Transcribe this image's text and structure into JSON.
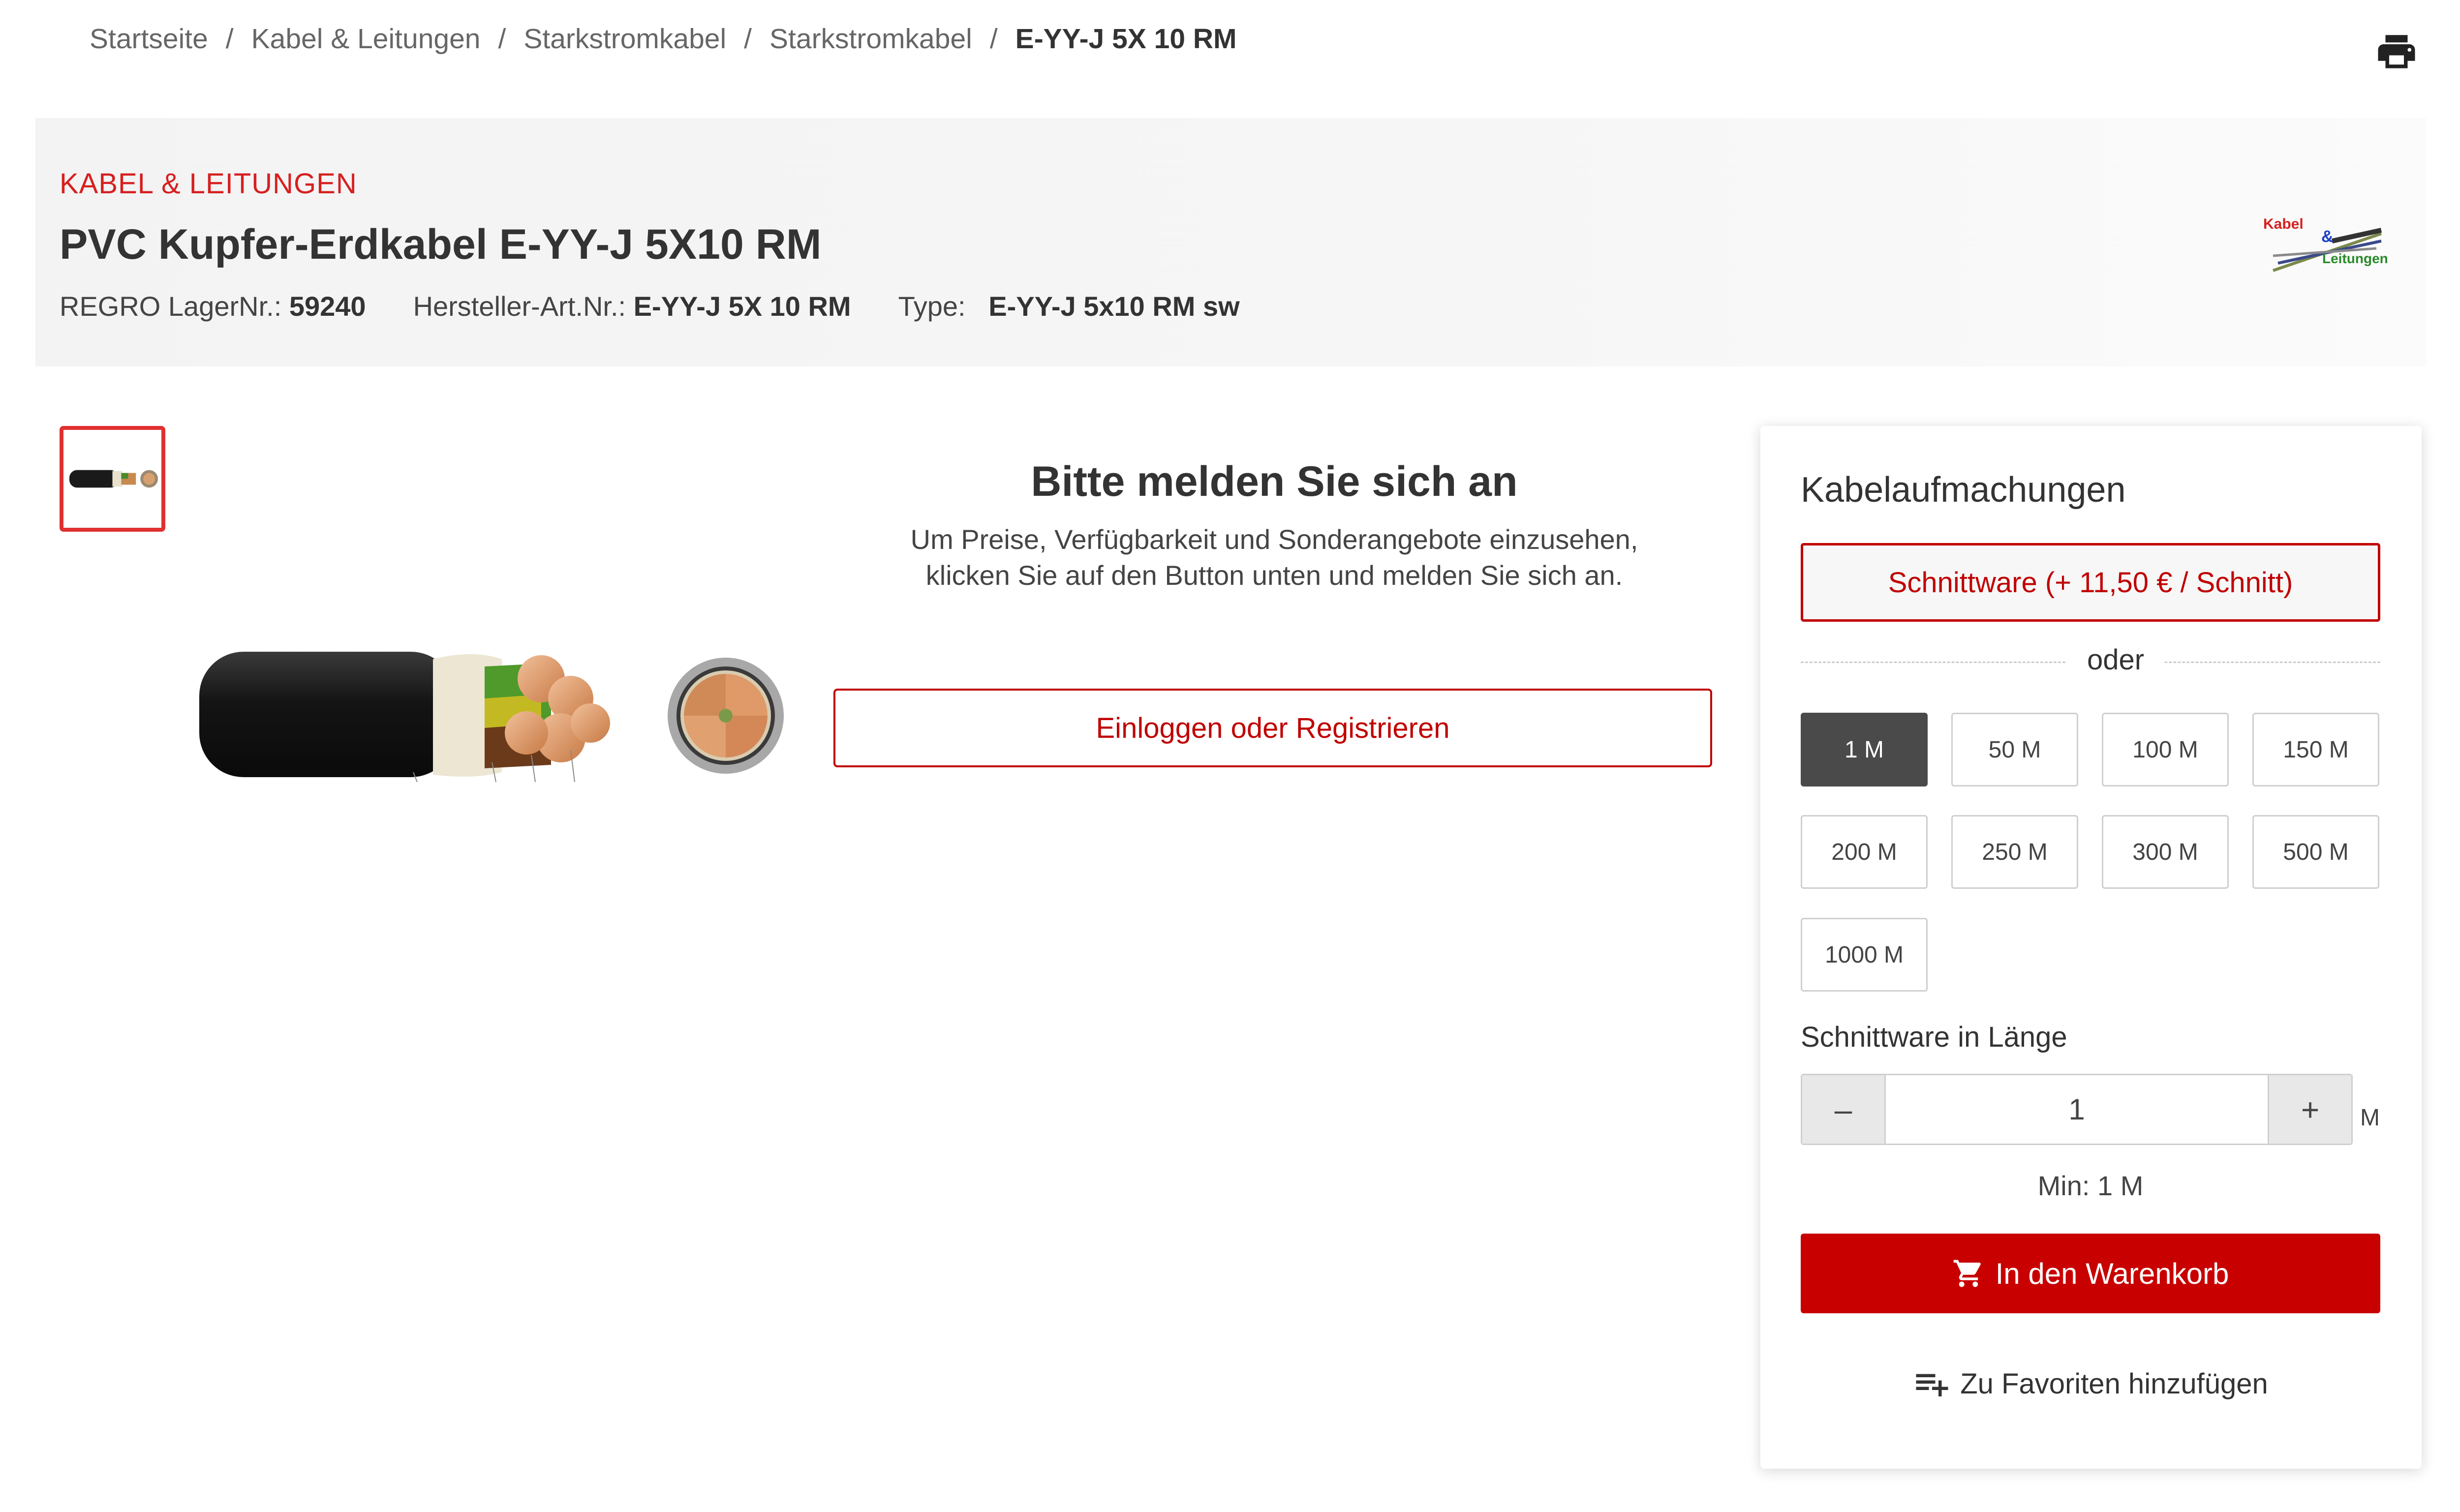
{
  "breadcrumb": {
    "items": [
      "Startseite",
      "Kabel & Leitungen",
      "Starkstromkabel",
      "Starkstromkabel"
    ],
    "separator": "/",
    "current": "E-YY-J 5X 10 RM"
  },
  "header": {
    "category": "KABEL & LEITUNGEN",
    "title": "PVC Kupfer-Erdkabel E-YY-J 5X10 RM",
    "meta": {
      "lager_label": "REGRO LagerNr.:",
      "lager_value": "59240",
      "hersteller_label": "Hersteller-Art.Nr.:",
      "hersteller_value": "E-YY-J 5X 10 RM",
      "type_label": "Type:",
      "type_value": "E-YY-J 5x10 RM sw"
    },
    "brand_logo": {
      "line1": "Kabel",
      "amp": "&",
      "line2": "Leitungen"
    }
  },
  "login": {
    "title": "Bitte melden Sie sich an",
    "text": "Um Preise, Verfügbarkeit und Sonderangebote einzusehen, klicken Sie auf den Button unten und melden Sie sich an.",
    "button": "Einloggen oder Registrieren"
  },
  "panel": {
    "title": "Kabelaufmachungen",
    "cut_button": "Schnittware (+ 11,50 € / Schnitt)",
    "or_label": "oder",
    "lengths": [
      "1 M",
      "50 M",
      "100 M",
      "150 M",
      "200 M",
      "250 M",
      "300 M",
      "500 M",
      "1000 M"
    ],
    "selected_length": "1 M",
    "length_label": "Schnittware in Länge",
    "stepper": {
      "minus": "–",
      "value": "1",
      "plus": "+",
      "unit": "M"
    },
    "min_text": "Min: 1 M",
    "cart_button": "In den Warenkorb",
    "favorites_button": "Zu Favoriten hinzufügen"
  },
  "colors": {
    "accent_red": "#c80000",
    "category_red": "#d62020",
    "selected_dark": "#4a4a4a",
    "header_band": "#f4f4f4"
  },
  "icons": {
    "print": "print-icon",
    "cart": "cart-icon",
    "favorites": "playlist-add-icon"
  }
}
